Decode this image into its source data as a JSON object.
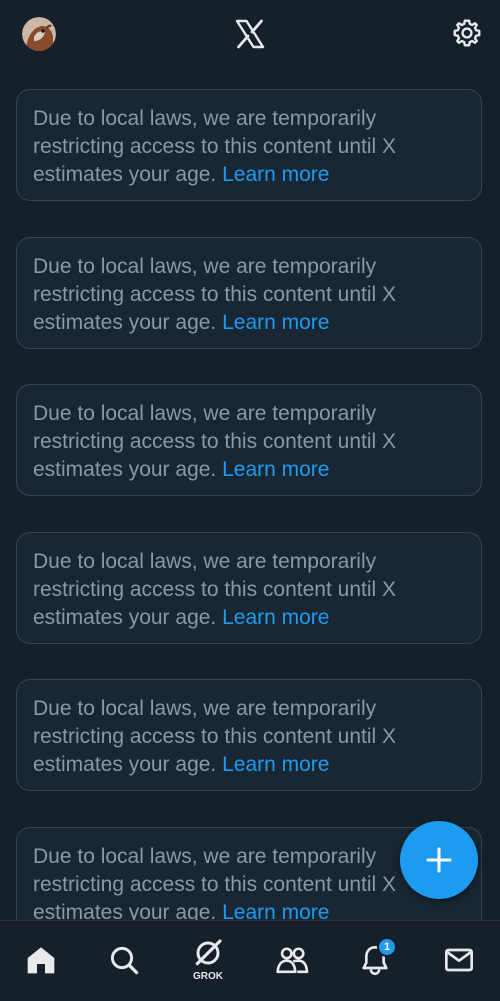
{
  "header": {
    "avatar_icon": "profile-avatar",
    "logo_icon": "x-logo",
    "settings_icon": "gear-icon"
  },
  "feed": {
    "notices": [
      {
        "text": "Due to local laws, we are temporarily restricting access to this content until X estimates your age. ",
        "link": "Learn more"
      },
      {
        "text": "Due to local laws, we are temporarily restricting access to this content until X estimates your age. ",
        "link": "Learn more"
      },
      {
        "text": "Due to local laws, we are temporarily restricting access to this content until X estimates your age. ",
        "link": "Learn more"
      },
      {
        "text": "Due to local laws, we are temporarily restricting access to this content until X estimates your age. ",
        "link": "Learn more"
      },
      {
        "text": "Due to local laws, we are temporarily restricting access to this content until X estimates your age. ",
        "link": "Learn more"
      },
      {
        "text": "Due to local laws, we are temporarily restricting access to this content until X estimates your age. ",
        "link": "Learn more"
      }
    ]
  },
  "fab": {
    "icon": "plus-icon"
  },
  "bottom_nav": {
    "items": [
      {
        "icon": "home-icon"
      },
      {
        "icon": "search-icon"
      },
      {
        "icon": "grok-icon",
        "label": "GROK"
      },
      {
        "icon": "communities-icon"
      },
      {
        "icon": "bell-icon",
        "badge": "1"
      },
      {
        "icon": "mail-icon"
      }
    ]
  },
  "colors": {
    "background": "#15202b",
    "card": "#192734",
    "border": "#38444d",
    "text_muted": "#8b98a5",
    "accent": "#1d9bf0",
    "icon": "#e7e9ea"
  }
}
